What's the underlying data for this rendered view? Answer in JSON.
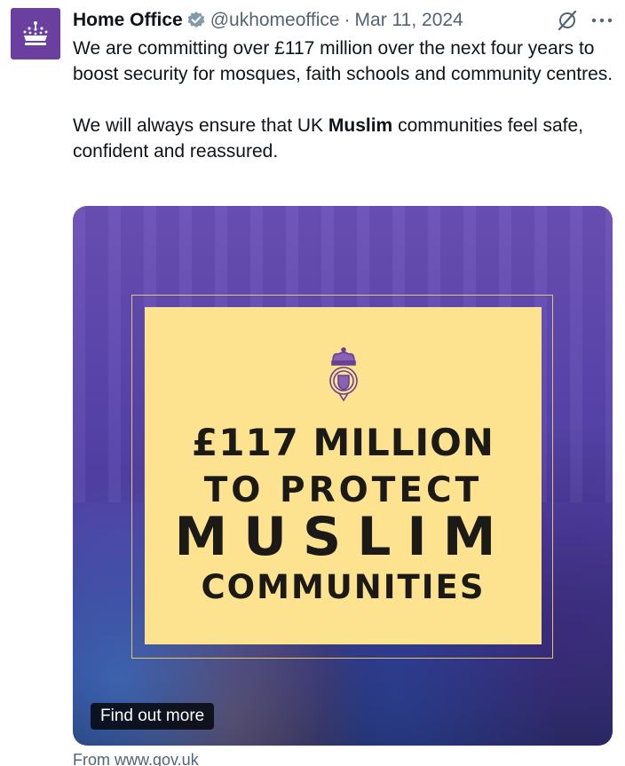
{
  "tweet": {
    "author_name": "Home Office",
    "handle": "@ukhomeoffice",
    "separator": "·",
    "date": "Mar 11, 2024",
    "avatar_icon": "crown-icon",
    "avatar_color": "#6b3fa0",
    "verified_icon": "verified-badge-icon",
    "verified_color": "#829aab",
    "text_para1": "We are committing over £117 million over the next four years to boost security for mosques, faith schools and community centres.",
    "text_para2_before": "We will always ensure that UK ",
    "text_para2_bold": "Muslim",
    "text_para2_after": " communities feel safe, confident and reassured."
  },
  "actions": {
    "grok_icon": "grok-icon",
    "more_icon": "more-options-icon"
  },
  "card": {
    "poster_color": "#fde38f",
    "crest_icon": "royal-crest-icon",
    "line1": "£117 MILLION",
    "line2": "TO PROTECT",
    "line3": "MUSLIM",
    "line4": "COMMUNITIES",
    "cta_label": "Find out more",
    "source": "From www.gov.uk"
  }
}
